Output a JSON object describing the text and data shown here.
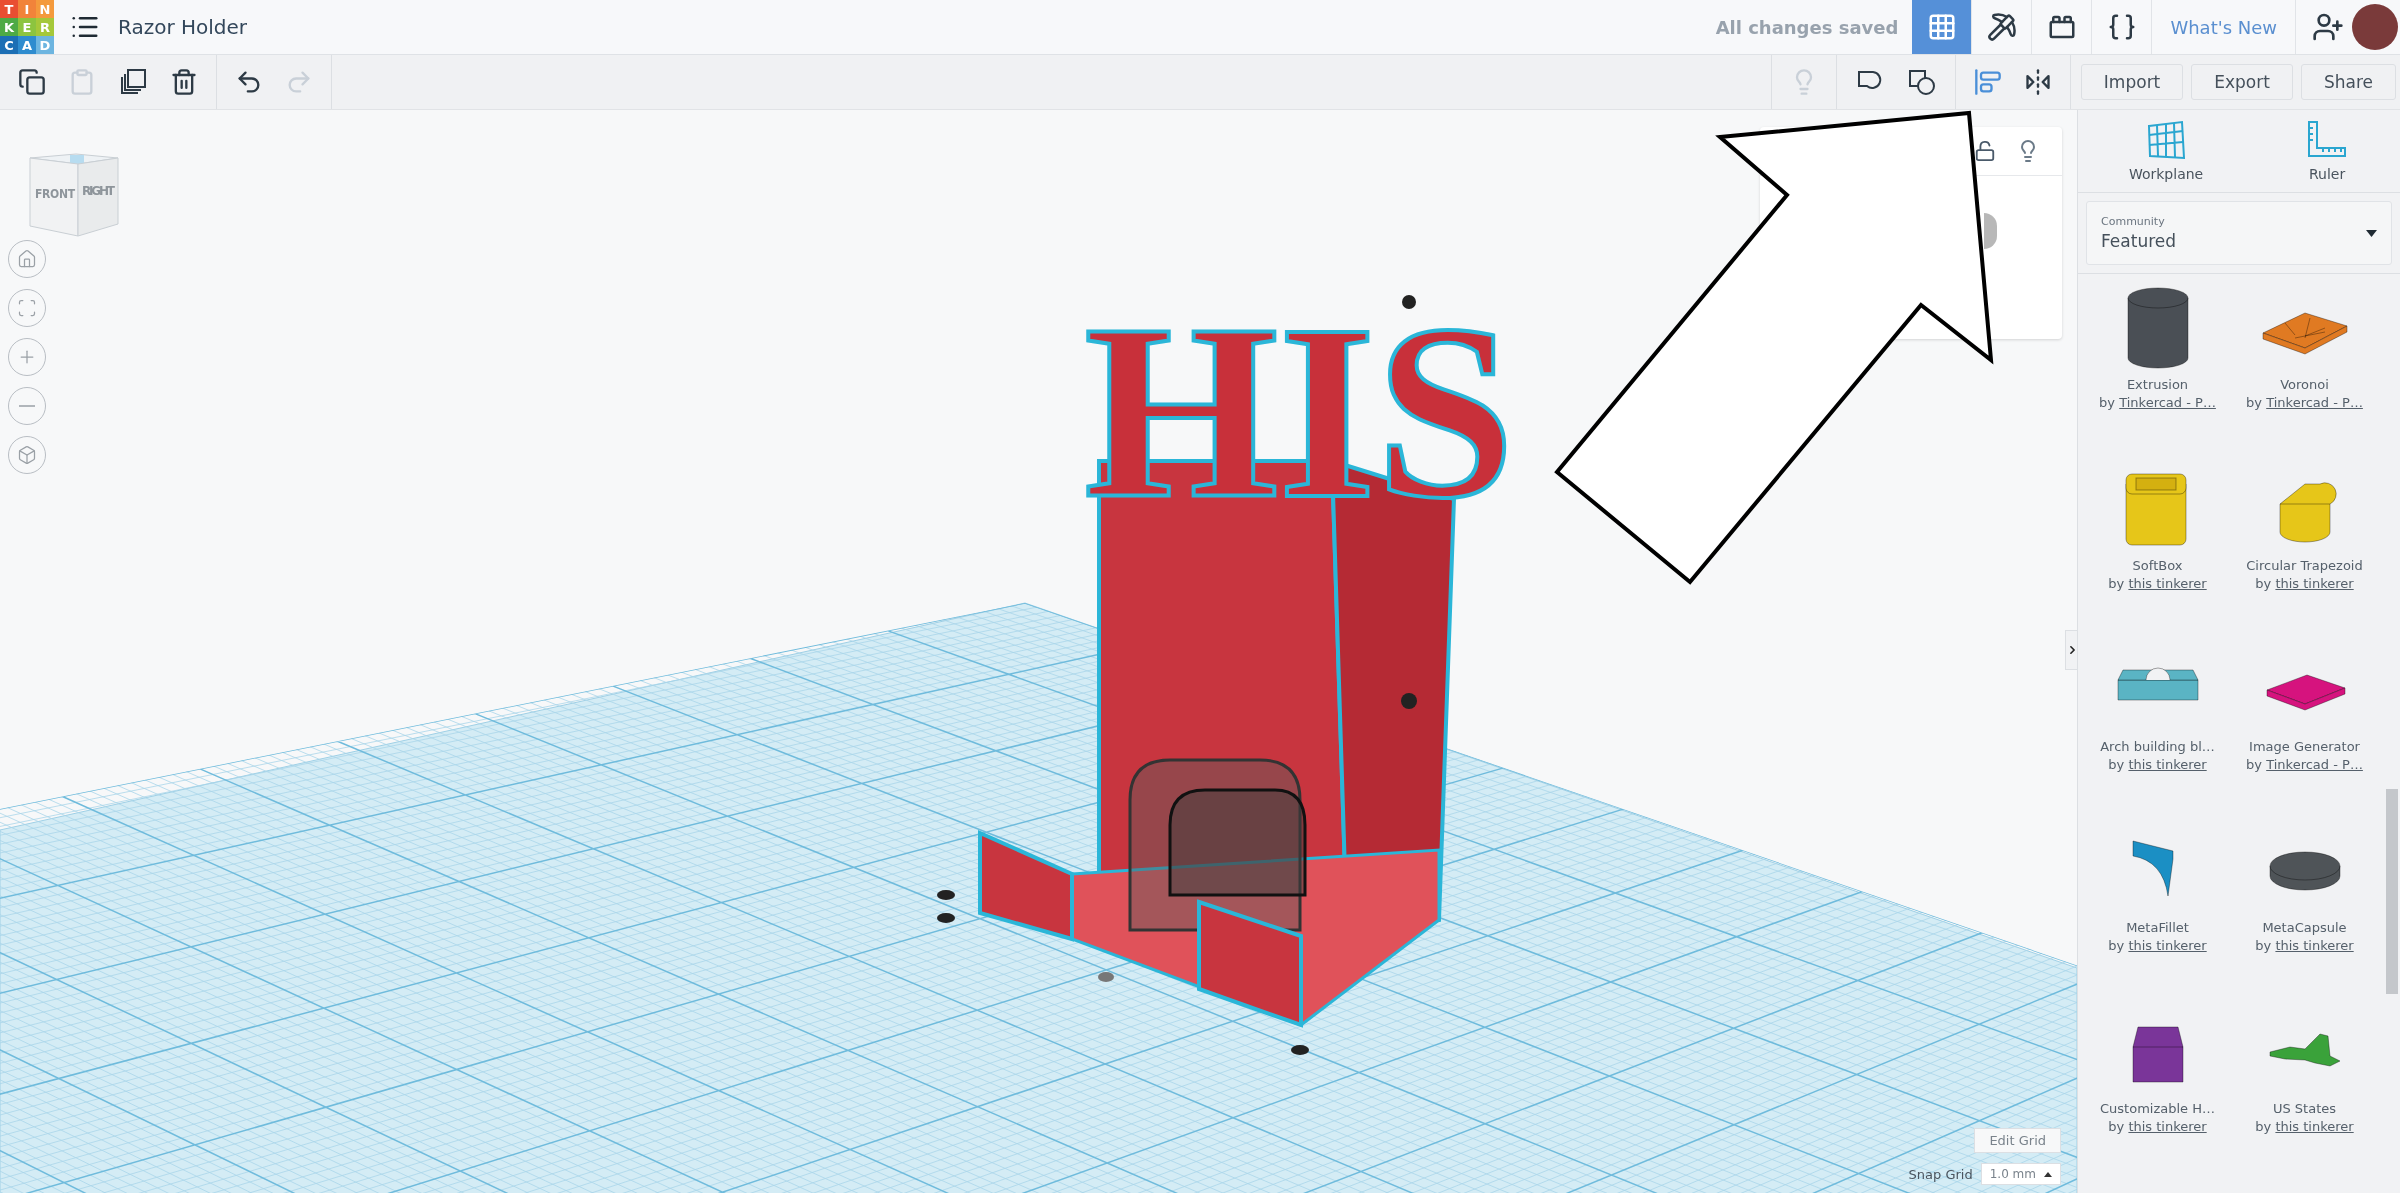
{
  "header": {
    "logo_tiles": [
      {
        "letter": "T",
        "color": "#e94e32"
      },
      {
        "letter": "I",
        "color": "#f1833a"
      },
      {
        "letter": "N",
        "color": "#f49a3c"
      },
      {
        "letter": "K",
        "color": "#4eaa45"
      },
      {
        "letter": "E",
        "color": "#8cc43f"
      },
      {
        "letter": "R",
        "color": "#a5c83a"
      },
      {
        "letter": "C",
        "color": "#1c6fb5"
      },
      {
        "letter": "A",
        "color": "#2e8ccf"
      },
      {
        "letter": "D",
        "color": "#6db5e0"
      }
    ],
    "title": "Razor Holder",
    "save_status": "All changes saved",
    "nav": [
      {
        "kind": "grid",
        "selected": true
      },
      {
        "kind": "pickaxe",
        "selected": false
      },
      {
        "kind": "bricks",
        "selected": false
      },
      {
        "kind": "code",
        "selected": false
      }
    ],
    "whats_new": "What's New"
  },
  "toolbar": {
    "left": [
      {
        "kind": "copy",
        "disabled": false
      },
      {
        "kind": "paste",
        "disabled": true
      },
      {
        "kind": "duplicate",
        "disabled": false
      },
      {
        "kind": "delete",
        "disabled": false
      },
      {
        "kind": "undo",
        "disabled": false
      },
      {
        "kind": "redo",
        "disabled": true
      }
    ],
    "right": [
      {
        "kind": "bulb",
        "disabled": true
      },
      {
        "kind": "group",
        "disabled": false
      },
      {
        "kind": "ungroup",
        "disabled": false
      },
      {
        "kind": "align",
        "disabled": false
      },
      {
        "kind": "mirror",
        "disabled": false
      }
    ],
    "buttons": [
      "Import",
      "Export",
      "Share"
    ]
  },
  "view_cube": {
    "front": "FRONT",
    "right": "RIGHT"
  },
  "view_controls": [
    {
      "kind": "home"
    },
    {
      "kind": "fit"
    },
    {
      "kind": "zoom_in"
    },
    {
      "kind": "zoom_out"
    },
    {
      "kind": "ortho"
    }
  ],
  "model": {
    "lettering": "HIS"
  },
  "grid_controls": {
    "edit_grid": "Edit Grid",
    "snap_label": "Snap Grid",
    "snap_value": "1.0 mm"
  },
  "sidebar": {
    "tools": [
      {
        "kind": "workplane",
        "label": "Workplane"
      },
      {
        "kind": "ruler",
        "label": "Ruler"
      }
    ],
    "library": {
      "label": "Community",
      "value": "Featured"
    },
    "shapes": [
      {
        "kind": "cylinder",
        "name": "Extrusion",
        "by": "by",
        "author": "Tinkercad - P…",
        "color": "#4a4f55"
      },
      {
        "kind": "tile",
        "name": "Voronoi",
        "by": "by",
        "author": "Tinkercad - P…",
        "color": "#e07a22"
      },
      {
        "kind": "softbox",
        "name": "SoftBox",
        "by": "by",
        "author": "this tinkerer",
        "color": "#e6c619"
      },
      {
        "kind": "trapezoid",
        "name": "Circular Trapezoid",
        "by": "by",
        "author": "this tinkerer",
        "color": "#e6c619"
      },
      {
        "kind": "arch",
        "name": "Arch building bl…",
        "by": "by",
        "author": "this tinkerer",
        "color": "#5ab4c4"
      },
      {
        "kind": "plate",
        "name": "Image Generator",
        "by": "by",
        "author": "Tinkercad - P…",
        "color": "#d6137e"
      },
      {
        "kind": "fillet",
        "name": "MetaFillet",
        "by": "by",
        "author": "this tinkerer",
        "color": "#1b8fc4"
      },
      {
        "kind": "capsule",
        "name": "MetaCapsule",
        "by": "by",
        "author": "this tinkerer",
        "color": "#4f5458"
      },
      {
        "kind": "house",
        "name": "Customizable H…",
        "by": "by",
        "author": "this tinkerer",
        "color": "#7a3599"
      },
      {
        "kind": "map",
        "name": "US States",
        "by": "by",
        "author": "this tinkerer",
        "color": "#3aa23a"
      }
    ]
  }
}
